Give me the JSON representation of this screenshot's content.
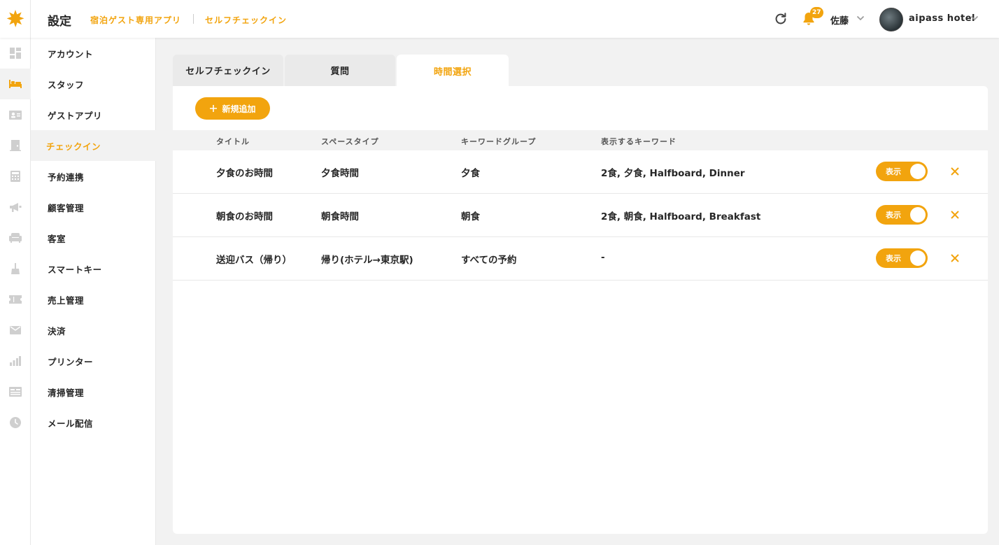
{
  "header": {
    "title": "設定",
    "breadcrumbs": [
      "宿泊ゲスト専用アプリ",
      "セルフチェックイン"
    ],
    "notification_count": "27",
    "user_name": "佐藤",
    "hotel_name": "aipass hotel",
    "accent_color": "#f2a40e"
  },
  "rail_icons": [
    "dashboard-icon",
    "bed-icon",
    "customer-card-icon",
    "door-icon",
    "calculator-icon",
    "megaphone-icon",
    "sofa-icon",
    "cleaning-icon",
    "ticket-icon",
    "mail-icon",
    "bar-chart-icon",
    "list-icon",
    "clock-icon"
  ],
  "menu": {
    "items": [
      {
        "label": "アカウント"
      },
      {
        "label": "スタッフ"
      },
      {
        "label": "ゲストアプリ"
      },
      {
        "label": "チェックイン"
      },
      {
        "label": "予約連携"
      },
      {
        "label": "顧客管理"
      },
      {
        "label": "客室"
      },
      {
        "label": "スマートキー"
      },
      {
        "label": "売上管理"
      },
      {
        "label": "決済"
      },
      {
        "label": "プリンター"
      },
      {
        "label": "清掃管理"
      },
      {
        "label": "メール配信"
      }
    ],
    "active_index": 3
  },
  "tabs": [
    {
      "label": "セルフチェックイン"
    },
    {
      "label": "質問"
    },
    {
      "label": "時間選択"
    }
  ],
  "active_tab": 2,
  "add_button": {
    "label": "新規追加"
  },
  "table": {
    "headers": [
      "タイトル",
      "スペースタイプ",
      "キーワードグループ",
      "表示するキーワード"
    ],
    "rows": [
      {
        "title": "夕食のお時間",
        "space_type": "夕食時間",
        "keyword_group": "夕食",
        "keywords": "2食, 夕食, Halfboard, Dinner",
        "display_label": "表示",
        "display_on": true
      },
      {
        "title": "朝食のお時間",
        "space_type": "朝食時間",
        "keyword_group": "朝食",
        "keywords": "2食, 朝食, Halfboard, Breakfast",
        "display_label": "表示",
        "display_on": true
      },
      {
        "title": "送迎バス（帰り）",
        "space_type": "帰り(ホテル→東京駅)",
        "keyword_group": "すべての予約",
        "keywords": "-",
        "display_label": "表示",
        "display_on": true
      }
    ]
  }
}
